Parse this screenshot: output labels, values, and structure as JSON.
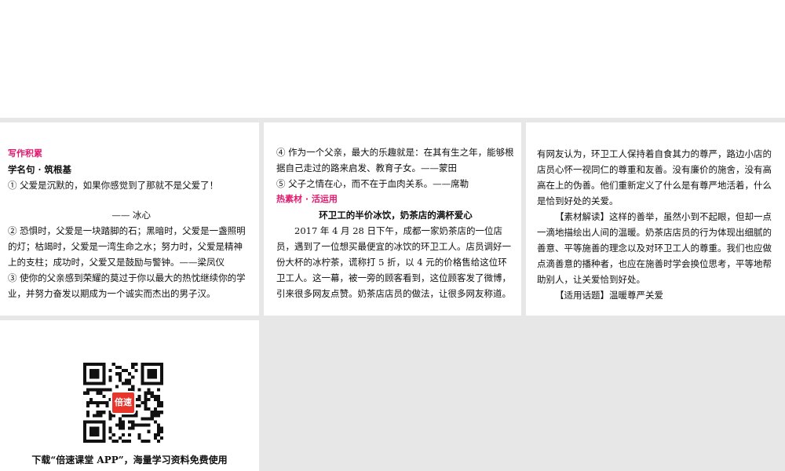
{
  "panel1": {
    "heading": "写作积累",
    "subheading": "学名句 · 筑根基",
    "item1": "① 父爱是沉默的，如果你感觉到了那就不是父爱了！",
    "item1_source": "—— 冰心",
    "item2": "② 恐惧时，父爱是一块踏脚的石；黑暗时，父爱是一盏照明的灯；枯竭时，父爱是一湾生命之水；努力时，父爱是精神上的支柱；成功时，父爱又是鼓励与警钟。——梁凤仪",
    "item3": "③ 使你的父亲感到荣耀的莫过于你以最大的热忱继续你的学业，并努力奋发以期成为一个诚实而杰出的男子汉。"
  },
  "panel2": {
    "item4": "④ 作为一个父亲，最大的乐趣就是：在其有生之年，能够根据自己走过的路来启发、教育子女。——蒙田",
    "item5": "⑤ 父子之情在心，而不在于血肉关系。——席勒",
    "heading": "热素材 · 活运用",
    "story_title": "环卫工的半价冰饮，奶茶店的满杯爱心",
    "story_body": "2017 年 4 月 28 日下午，成都一家奶茶店的一位店员，遇到了一位想买最便宜的冰饮的环卫工人。店员调好一份大杯的冰柠茶，谎称打 5 折，以 4 元的价格售给这位环卫工人。这一幕，被一旁的顾客看到，这位顾客发了微博，引来很多网友点赞。奶茶店店员的做法，让很多网友称道。"
  },
  "panel3": {
    "para1": "有网友认为，环卫工人保持着自食其力的尊严，路边小店的店员心怀一视同仁的尊重和友善。没有廉价的施舍，没有高高在上的伪善。他们重新定义了什么是有尊严地活着，什么是恰到好处的关爱。",
    "para2": "【素材解读】这样的善举，虽然小到不起眼，但却一点一滴地描绘出人间的温暖。奶茶店店员的行为体现出细腻的善意、平等施善的理念以及对环卫工人的尊重。我们也应做点滴善意的播种者，也应在施善时学会换位思考，平等地帮助别人，让关爱恰到好处。",
    "para3": "【适用话题】温暖尊严关爱"
  },
  "panel4": {
    "qr_logo_text": "倍速",
    "caption": "下载“倍速课堂 APP”，海量学习资料免费使用"
  }
}
